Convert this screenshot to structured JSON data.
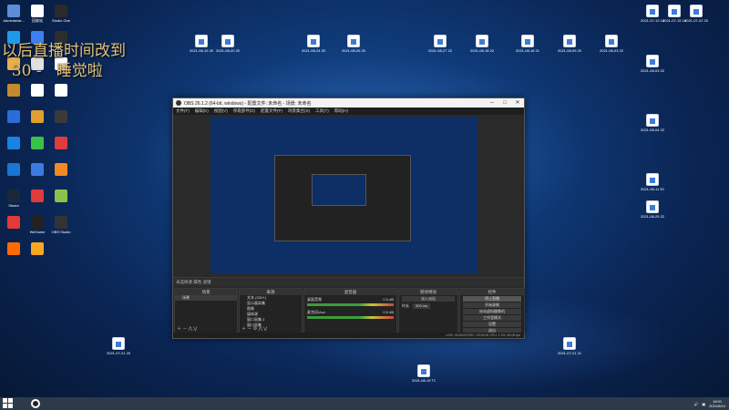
{
  "overlay_text": "以后直播时间改到\n  30 -   睡觉啦",
  "desktop_icons_left": [
    {
      "label": "Administrat...",
      "color": "#5b8ed6"
    },
    {
      "label": "回收站",
      "color": "#ffffff"
    },
    {
      "label": "Studio One",
      "color": "#2a2a2a"
    },
    {
      "label": "",
      "color": "#1e9be8"
    },
    {
      "label": "",
      "color": "#3c7ff0"
    },
    {
      "label": "",
      "color": "#2d2d2d"
    },
    {
      "label": "",
      "color": "#e6b04a"
    },
    {
      "label": "",
      "color": "#e0e0e0"
    },
    {
      "label": "",
      "color": "#ffffff"
    },
    {
      "label": "",
      "color": "#c48a2b"
    },
    {
      "label": "",
      "color": "#ffffff"
    },
    {
      "label": "",
      "color": "#ffffff"
    },
    {
      "label": "",
      "color": "#2b6cd9"
    },
    {
      "label": "",
      "color": "#e0a030"
    },
    {
      "label": "",
      "color": "#3a3a3a"
    },
    {
      "label": "",
      "color": "#1a82e0"
    },
    {
      "label": "",
      "color": "#39c24a"
    },
    {
      "label": "",
      "color": "#e23b3b"
    },
    {
      "label": "",
      "color": "#1976d2"
    },
    {
      "label": "",
      "color": "#3a7be0"
    },
    {
      "label": "",
      "color": "#f08a24"
    },
    {
      "label": "Steam",
      "color": "#1b2838"
    },
    {
      "label": "",
      "color": "#e03a3a"
    },
    {
      "label": "",
      "color": "#8bc34a"
    },
    {
      "label": "",
      "color": "#e53935"
    },
    {
      "label": "WeGame",
      "color": "#222"
    },
    {
      "label": "OBS Studio",
      "color": "#333"
    },
    {
      "label": "",
      "color": "#ff6b00"
    },
    {
      "label": "",
      "color": "#f5a623"
    }
  ],
  "desktop_files": [
    {
      "label": "2021-08-19 20-22-42..."
    },
    {
      "label": "2021-08-20 20-14-10..."
    },
    {
      "label": "2021-08-24 20-26-21..."
    },
    {
      "label": "2021-08-26 20-21-29..."
    },
    {
      "label": "2021-08-27 22-17-03..."
    },
    {
      "label": "2021-08-18 22-41-14..."
    },
    {
      "label": "2021-08-18 21-16-05..."
    },
    {
      "label": "2021-08-09 20-03-55..."
    },
    {
      "label": "2021-08-03 22-04-48..."
    }
  ],
  "desktop_right_files": [
    {
      "label": "2021-07-13 14-35-10..."
    },
    {
      "label": "2021-07-15 14-22-32..."
    },
    {
      "label": "2021-07-22 20-45-21..."
    },
    {
      "label": "2021-08-03 22-12-24..."
    },
    {
      "label": "2021-08-04 22-10-33..."
    },
    {
      "label": "2021-08-11 20-49-26..."
    },
    {
      "label": "2021-08-25 22-41-26..."
    }
  ],
  "desktop_bottom_files": [
    {
      "label": "2021-07-21 20-23-06..."
    },
    {
      "label": "2021-07-21 21-33-07..."
    },
    {
      "label": "2021-08-19 TC CC..."
    }
  ],
  "obs": {
    "title": "OBS 26.1.2 (64-bit, windows) - 配置文件: 未命名 - 场景: 未命名",
    "menu": [
      "文件(F)",
      "编辑(E)",
      "视图(V)",
      "停靠部件(D)",
      "配置文件(P)",
      "场景集合(S)",
      "工具(T)",
      "帮助(H)"
    ],
    "bottom_bar": "未选择源    属性    滤镜",
    "docks": {
      "scenes": {
        "header": "场景",
        "items": [
          "场景"
        ]
      },
      "sources": {
        "header": "来源",
        "items": [
          "文本 (GDI+)",
          "显示器采集",
          "图像",
          "媒体源",
          "窗口采集 2",
          "窗口采集"
        ]
      },
      "mixer": {
        "header": "混音器",
        "items": [
          {
            "name": "桌面音频",
            "db": "0.0 dB"
          },
          {
            "name": "麦克风/Aux",
            "db": "0.0 dB"
          }
        ]
      },
      "transitions": {
        "header": "转场特效",
        "selected": "淡入淡出",
        "duration_label": "时长",
        "duration": "300 ms"
      },
      "controls": {
        "header": "控件",
        "buttons": [
          "停止直播",
          "开始录制",
          "启动虚拟摄像机",
          "工作室模式",
          "设置",
          "退出"
        ]
      }
    },
    "status": "LIVE: 00:00:00  REC: 00:00:00  CPU: 1.2%, 60.00 fps"
  },
  "taskbar": {
    "time": "18:01",
    "date": "2021/8/14"
  },
  "colors": {
    "accent": "#1f5aa6",
    "overlay_text": "#e2c277",
    "obs_bg": "#2a2a2a"
  }
}
